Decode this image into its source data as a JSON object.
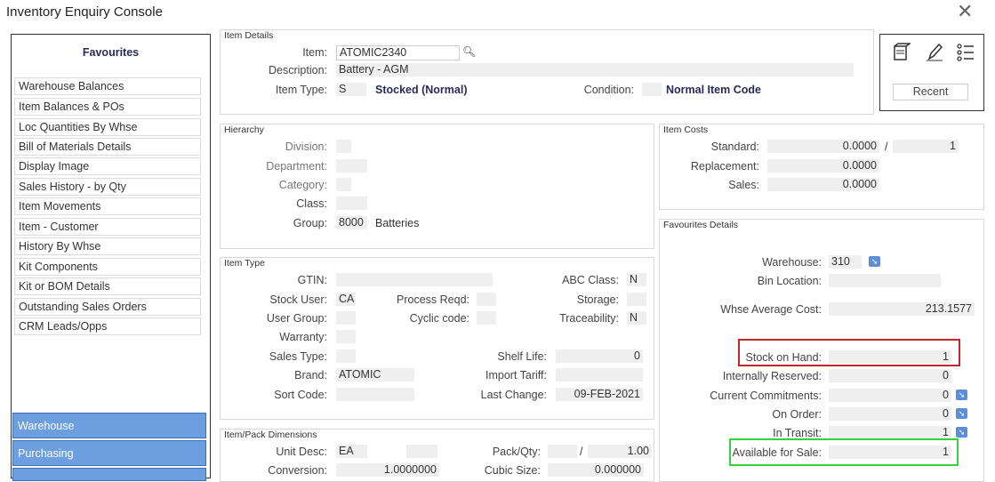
{
  "window": {
    "title": "Inventory Enquiry Console"
  },
  "favourites": {
    "title": "Favourites",
    "items": [
      "Warehouse Balances",
      "Item Balances & POs",
      "Loc Quantities By Whse",
      "Bill of Materials Details",
      "Display Image",
      "Sales History - by Qty",
      "Item Movements",
      "Item - Customer",
      "History By Whse",
      "Kit Components",
      "Kit or BOM Details",
      "Outstanding Sales Orders",
      "CRM Leads/Opps"
    ],
    "nav": [
      "Warehouse",
      "Purchasing"
    ]
  },
  "item_details": {
    "title": "Item Details",
    "item_label": "Item:",
    "item_value": "ATOMIC2340",
    "desc_label": "Description:",
    "desc_value": "Battery - AGM",
    "type_label": "Item Type:",
    "type_code": "S",
    "type_text": "Stocked (Normal)",
    "cond_label": "Condition:",
    "cond_code": "",
    "cond_text": "Normal Item Code"
  },
  "toolbar": {
    "recent_label": "Recent"
  },
  "hierarchy": {
    "title": "Hierarchy",
    "division_label": "Division:",
    "division": "",
    "department_label": "Department:",
    "department": "",
    "category_label": "Category:",
    "category": "",
    "class_label": "Class:",
    "class": "",
    "group_label": "Group:",
    "group_code": "8000",
    "group_text": "Batteries"
  },
  "item_costs": {
    "title": "Item Costs",
    "standard_label": "Standard:",
    "standard": "0.0000",
    "slash": "/",
    "standard_qty": "1",
    "replacement_label": "Replacement:",
    "replacement": "0.0000",
    "sales_label": "Sales:",
    "sales": "0.0000"
  },
  "item_type": {
    "title": "Item Type",
    "gtin_label": "GTIN:",
    "gtin": "",
    "abc_label": "ABC Class:",
    "abc": "N",
    "stock_user_label": "Stock User:",
    "stock_user": "CA",
    "process_label": "Process Reqd:",
    "process": "",
    "storage_label": "Storage:",
    "storage": "",
    "user_group_label": "User Group:",
    "user_group": "",
    "cyclic_label": "Cyclic code:",
    "cyclic": "",
    "trace_label": "Traceability:",
    "trace": "N",
    "warranty_label": "Warranty:",
    "warranty": "",
    "sales_type_label": "Sales Type:",
    "sales_type": "",
    "shelf_label": "Shelf Life:",
    "shelf": "0",
    "brand_label": "Brand:",
    "brand": "ATOMIC",
    "tariff_label": "Import Tariff:",
    "tariff": "",
    "sort_label": "Sort Code:",
    "sort": "",
    "last_change_label": "Last Change:",
    "last_change": "09-FEB-2021"
  },
  "pack": {
    "title": "Item/Pack Dimensions",
    "unit_label": "Unit Desc:",
    "unit": "EA",
    "unit2": "",
    "packqty_label": "Pack/Qty:",
    "pack_a": "",
    "slash": "/",
    "pack_b": "1.00",
    "conv_label": "Conversion:",
    "conv": "1.0000000",
    "cubic_label": "Cubic Size:",
    "cubic": "0.000000"
  },
  "fav_details": {
    "title": "Favourites Details",
    "warehouse_label": "Warehouse:",
    "warehouse": "310",
    "bin_label": "Bin Location:",
    "bin": "",
    "avg_cost_label": "Whse Average Cost:",
    "avg_cost": "213.1577",
    "soh_label": "Stock on Hand:",
    "soh": "1",
    "reserved_label": "Internally Reserved:",
    "reserved": "0",
    "commit_label": "Current Commitments:",
    "commit": "0",
    "onorder_label": "On Order:",
    "onorder": "0",
    "transit_label": "In Transit:",
    "transit": "1",
    "afs_label": "Available for Sale:",
    "afs": "1"
  },
  "colors": {
    "accent_blue": "#6c9ee0",
    "highlight_red": "#c0262d",
    "highlight_green": "#39d13b",
    "label_bold": "#2a2a5a"
  }
}
